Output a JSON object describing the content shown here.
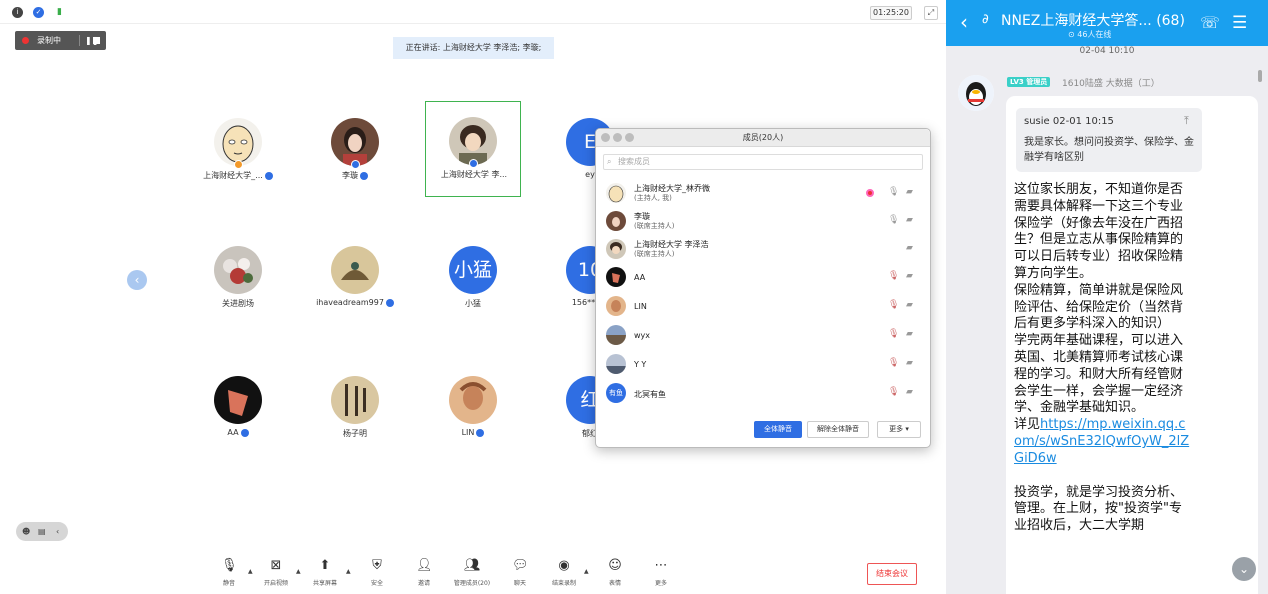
{
  "meeting": {
    "timer": "01:25:20",
    "recording": {
      "label": "录制中",
      "pause_icon": "pause-icon",
      "stop_icon": "stop-icon"
    },
    "speaking_banner": "正在讲话: 上海财经大学 李泽浩; 李璇;",
    "tiles": [
      {
        "name": "上海财经大学_...",
        "avatar": "cartoon-bald-face"
      },
      {
        "name": "李璇",
        "avatar": "photo-girl"
      },
      {
        "name": "上海财经大学 李...",
        "avatar": "photo-boy",
        "active": true
      },
      {
        "name": "ey",
        "avatar_text": "E"
      },
      {
        "name": "关进剧场",
        "avatar": "photo-flowers"
      },
      {
        "name": "ihaveadream997",
        "avatar": "photo-painting"
      },
      {
        "name": "小猛",
        "avatar_text": "小猛"
      },
      {
        "name": "156****0",
        "avatar_text": "10"
      },
      {
        "name": "AA",
        "avatar": "photo-dark-art"
      },
      {
        "name": "杨子明",
        "avatar": "photo-calligraphy"
      },
      {
        "name": "LIN",
        "avatar": "photo-statue"
      },
      {
        "name": "郁红",
        "avatar_text": "红"
      }
    ],
    "toolbar": [
      {
        "label": "静音",
        "icon": "microphone-icon"
      },
      {
        "label": "开启视频",
        "icon": "camera-off-icon"
      },
      {
        "label": "共享屏幕",
        "icon": "share-screen-icon"
      },
      {
        "label": "安全",
        "icon": "shield-icon"
      },
      {
        "label": "邀请",
        "icon": "invite-icon"
      },
      {
        "label": "管理成员(20)",
        "icon": "members-icon"
      },
      {
        "label": "聊天",
        "icon": "chat-icon"
      },
      {
        "label": "结束录制",
        "icon": "record-icon"
      },
      {
        "label": "表情",
        "icon": "emoji-icon"
      },
      {
        "label": "更多",
        "icon": "more-icon"
      }
    ],
    "end_button": "结束会议"
  },
  "members": {
    "title": "成员(20人)",
    "search_placeholder": "搜索成员",
    "list": [
      {
        "name": "上海财经大学_林乔微",
        "role": "(主持人, 我)",
        "recording": true,
        "mic": true,
        "cam": true
      },
      {
        "name": "李璇",
        "role": "(联席主持人)",
        "mic": true,
        "cam": true
      },
      {
        "name": "上海财经大学 李泽浩",
        "role": "(联席主持人)",
        "cam": true
      },
      {
        "name": "AA",
        "mic_muted": true,
        "cam": true
      },
      {
        "name": "LIN",
        "mic_muted": true,
        "cam": true
      },
      {
        "name": "wyx",
        "mic_muted": true,
        "cam": true
      },
      {
        "name": "Y Y",
        "mic_muted": true,
        "cam": true
      },
      {
        "name": "北冥有鱼",
        "avatar_text": "有鱼",
        "mic_muted": true,
        "cam": true
      }
    ],
    "buttons": {
      "mute_all": "全体静音",
      "unmute_all": "解除全体静音",
      "more": "更多 ▾"
    }
  },
  "chat": {
    "title": "NNEZ上海财经大学答...",
    "count": "(68)",
    "online": "⊙ 46人在线",
    "time": "02-04 10:10",
    "sender": {
      "level": "LV3 管理员",
      "name": "1610陆盛 大数据（工）"
    },
    "quote": {
      "head": "susie 02-01 10:15",
      "text": "我是家长。想问问投资学、保险学、金融学有啥区别"
    },
    "message": {
      "p1": "这位家长朋友，不知道你是否需要具体解释一下这三个专业",
      "p2": "保险学（好像去年没在广西招生？但是立志从事保险精算的可以日后转专业）招收保险精算方向学生。",
      "p3": "保险精算，简单讲就是保险风险评估、给保险定价（当然背后有更多学科深入的知识）",
      "p4": "学完两年基础课程，可以进入英国、北美精算师考试核心课程的学习。和财大所有经管财会学生一样，会学握一定经济学、金融学基础知识。",
      "p5_prefix": "详见",
      "link": "https://mp.weixin.qq.com/s/wSnE32lQwfOyW_2lZGiD6w",
      "p6": "投资学，就是学习投资分析、管理。在上财，按\"投资学\"专业招收后，大二大学期"
    }
  }
}
